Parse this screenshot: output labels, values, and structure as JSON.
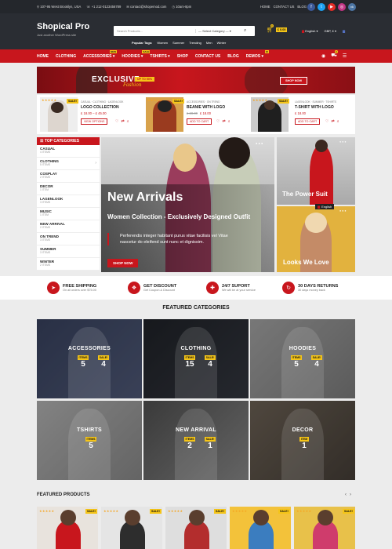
{
  "topbar": {
    "address": "107-95 West Brooklyn, USA",
    "phone": "+1 212-0123456789",
    "email": "contact@shopemod.com",
    "hours": "10am-8pm",
    "links": [
      "HOME",
      "CONTACT US",
      "BLOG"
    ]
  },
  "header": {
    "logo": "Shopical Pro",
    "tagline": "Just another WordPress site",
    "search_placeholder": "Search Products...",
    "category_select": "— Select Category —",
    "popular_label": "Popular Tags:",
    "popular_tags": [
      "Women",
      "Summer",
      "Trending",
      "Men",
      "Winter"
    ],
    "cart_count": "0",
    "cart_total": "£ 0.00",
    "language": "English",
    "currency": "GBP, £"
  },
  "nav": {
    "items": [
      {
        "label": "HOME",
        "tag": ""
      },
      {
        "label": "CLOTHING",
        "tag": ""
      },
      {
        "label": "ACCESSORIES",
        "tag": "NEW"
      },
      {
        "label": "HOODIES",
        "tag": "SALE"
      },
      {
        "label": "TSHIRTS",
        "tag": ""
      },
      {
        "label": "SHOP",
        "tag": ""
      },
      {
        "label": "CONTACT US",
        "tag": ""
      },
      {
        "label": "BLOG",
        "tag": ""
      },
      {
        "label": "DEMOS",
        "tag": "15"
      }
    ],
    "cart_count": "0"
  },
  "promo_banner": {
    "text": "EXCLUSIVE",
    "script": "Fashion",
    "tag": "UP TO 50%",
    "button": "SHOP NOW"
  },
  "top_products": [
    {
      "category": "CASUAL · CLOTHING · LAGENLOOK",
      "name": "LOGO COLLECTION",
      "price": "£ 18.00 – £ 45.00",
      "old_price": "",
      "button": "VIEW OPTIONS",
      "sale": "SALE!"
    },
    {
      "category": "ACCESSORIES · ON TREND",
      "name": "BEANIE WITH LOGO",
      "price": "£ 18.00",
      "old_price": "£ 20.00",
      "button": "ADD TO CART",
      "sale": "SALE!"
    },
    {
      "category": "LAGENLOOK · SUMMER · TSHIRTS",
      "name": "T-SHIRT WITH LOGO",
      "price": "£ 18.00",
      "old_price": "",
      "button": "ADD TO CART",
      "sale": "SALE!"
    }
  ],
  "sidebar": {
    "title": "TOP CATEGORIES",
    "items": [
      {
        "name": "CASUAL",
        "count": "4 ITEMS"
      },
      {
        "name": "CLOTHING",
        "count": "5 ITEMS"
      },
      {
        "name": "COSPLAY",
        "count": "2 ITEMS"
      },
      {
        "name": "DECOR",
        "count": "1 ITEM"
      },
      {
        "name": "LAGENLOOK",
        "count": "3 ITEMS"
      },
      {
        "name": "MUSIC",
        "count": "1 ITEM"
      },
      {
        "name": "NEW ARRIVAL",
        "count": "2 ITEMS"
      },
      {
        "name": "ON TREND",
        "count": "3 ITEMS"
      },
      {
        "name": "SUMMER",
        "count": "3 ITEMS"
      },
      {
        "name": "WINTER",
        "count": "2 ITEMS"
      }
    ]
  },
  "hero": {
    "title": "New Arrivals",
    "subtitle": "Women Collection - Exclusively Designed Outfit",
    "body": "Perferendis integer habitant purus vitae facilisis vel Vitae nascetur do eleifend sunt nunc et dignissim.",
    "button": "SHOP NOW"
  },
  "side_banners": [
    {
      "title": "The Power Suit"
    },
    {
      "title": "Looks We Love"
    }
  ],
  "lang_badge": "English",
  "features": [
    {
      "icon": "plane-icon",
      "title": "FREE SHIPPING",
      "sub": "On all orders over $75.00"
    },
    {
      "icon": "gift-icon",
      "title": "GET DISCOUNT",
      "sub": "Get Coupon & Discount"
    },
    {
      "icon": "support-icon",
      "title": "24/7 SUPORT",
      "sub": "We will be at your service"
    },
    {
      "icon": "return-icon",
      "title": "30 DAYS RETURNS",
      "sub": "30 days money back"
    }
  ],
  "featured_categories": {
    "title": "FEATURED CATEGORIES",
    "items": [
      {
        "name": "ACCESSORIES",
        "items_label": "ITEMS",
        "items": "5",
        "sale_label": "SALE!",
        "sale": "4"
      },
      {
        "name": "CLOTHING",
        "items_label": "ITEMS",
        "items": "15",
        "sale_label": "SALE!",
        "sale": "4"
      },
      {
        "name": "HOODIES",
        "items_label": "ITEMS",
        "items": "5",
        "sale_label": "SALE!",
        "sale": "4"
      },
      {
        "name": "TSHIRTS",
        "items_label": "ITEMS",
        "items": "5",
        "sale_label": "",
        "sale": ""
      },
      {
        "name": "NEW ARRIVAL",
        "items_label": "ITEMS",
        "items": "2",
        "sale_label": "SALE!",
        "sale": "1"
      },
      {
        "name": "DECOR",
        "items_label": "ITEM",
        "items": "1",
        "sale_label": "",
        "sale": ""
      }
    ]
  },
  "featured_products": {
    "title": "FEATURED PRODUCTS",
    "items": [
      {
        "sale": "SALE!"
      },
      {
        "sale": "SALE!"
      },
      {
        "sale": "SALE!"
      },
      {
        "sale": "SALE!"
      },
      {
        "sale": "SALE!"
      }
    ]
  },
  "colors": {
    "accent": "#c8161d",
    "dark": "#2a2d33",
    "badge": "#f5c518"
  }
}
